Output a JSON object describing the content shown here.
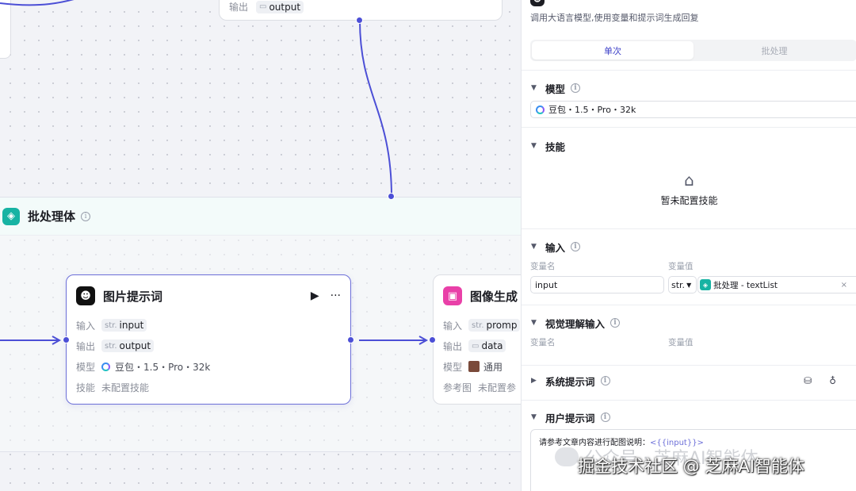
{
  "canvas": {
    "top_node": {
      "output_label": "输出",
      "output_value": "output"
    },
    "batch_group": {
      "title": "批处理体",
      "icon": "layers-icon"
    },
    "image_prompt_node": {
      "title": "图片提示词",
      "icon": "face-icon",
      "run_icon": "play-icon",
      "more_icon": "more-icon",
      "rows": {
        "input_label": "输入",
        "input_type": "str.",
        "input_value": "input",
        "output_label": "输出",
        "output_type": "str.",
        "output_value": "output",
        "model_label": "模型",
        "model_value": "豆包・1.5・Pro・32k",
        "skill_label": "技能",
        "skill_value": "未配置技能"
      }
    },
    "image_gen_node": {
      "title": "图像生成",
      "icon": "image-icon",
      "rows": {
        "input_label": "输入",
        "input_type": "str.",
        "input_value": "promp",
        "output_label": "输出",
        "output_value": "data",
        "model_label": "模型",
        "model_value": "通用",
        "ref_label": "参考图",
        "ref_value": "未配置参"
      }
    }
  },
  "panel": {
    "description": "调用大语言模型,使用变量和提示词生成回复",
    "tabs": [
      {
        "label": "单次",
        "active": true
      },
      {
        "label": "批处理",
        "active": false
      }
    ],
    "model": {
      "title": "模型",
      "value": "豆包・1.5・Pro・32k"
    },
    "skills": {
      "title": "技能",
      "empty": "暂未配置技能"
    },
    "input": {
      "title": "输入",
      "col_name": "变量名",
      "col_value": "变量值",
      "name": "input",
      "type": "str.",
      "value": "批处理 - textList"
    },
    "vision_input": {
      "title": "视觉理解输入",
      "col_name": "变量名",
      "col_value": "变量值"
    },
    "system_prompt": {
      "title": "系统提示词"
    },
    "user_prompt": {
      "title": "用户提示词",
      "text": "请参考文章内容进行配图说明：",
      "variable": "<{{input}}>"
    }
  },
  "watermark": {
    "line1": "公众号 · 芝麻AI智能体",
    "line2": "掘金技术社区 @ 芝麻AI智能体"
  },
  "colors": {
    "accent": "#4c4fd6",
    "teal": "#17b3a3",
    "pink": "#e940a8"
  }
}
